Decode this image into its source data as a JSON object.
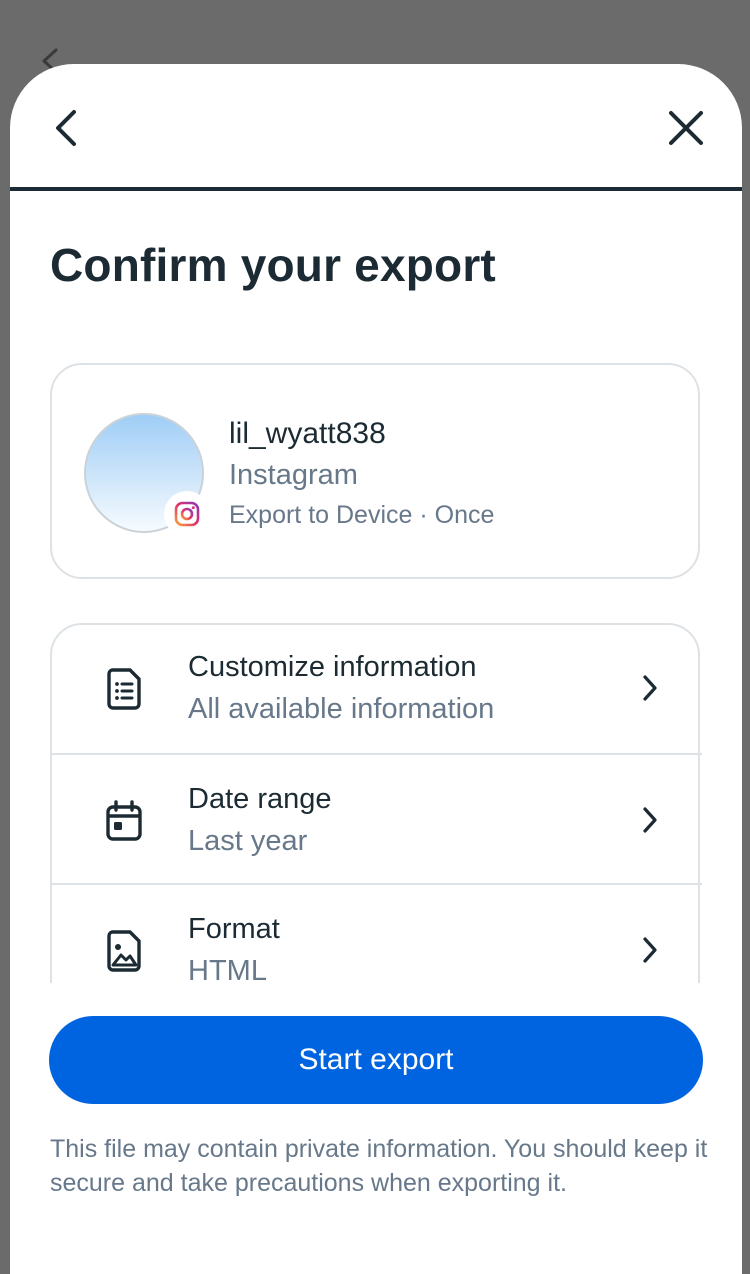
{
  "header": {
    "title": "Confirm your export"
  },
  "account": {
    "username": "lil_wyatt838",
    "app": "Instagram",
    "meta": "Export to Device · Once"
  },
  "options": [
    {
      "title": "Customize information",
      "subtitle": "All available information",
      "icon": "document-list-icon"
    },
    {
      "title": "Date range",
      "subtitle": "Last year",
      "icon": "calendar-icon"
    },
    {
      "title": "Format",
      "subtitle": "HTML",
      "icon": "image-file-icon"
    }
  ],
  "actions": {
    "start_label": "Start export"
  },
  "disclaimer": "This file may contain private information. You should keep it secure and take precautions when exporting it.",
  "colors": {
    "accent": "#0064e0",
    "text_primary": "#1c2b33",
    "text_secondary": "#67788a",
    "border": "#dde2e6",
    "overlay": "#6b6b6b"
  }
}
